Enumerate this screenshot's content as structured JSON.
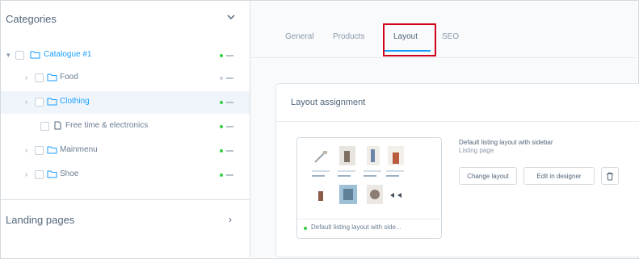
{
  "sidebar": {
    "title": "Categories",
    "tree": [
      {
        "label": "Catalogue #1",
        "color": "blue"
      },
      {
        "label": "Food",
        "color": "grey"
      },
      {
        "label": "Clothing",
        "color": "blue"
      },
      {
        "label": "Free time & electronics",
        "color": "grey"
      },
      {
        "label": "Mainmenu",
        "color": "grey"
      },
      {
        "label": "Shoe",
        "color": "grey"
      }
    ],
    "landing_pages_title": "Landing pages",
    "landing_pages_arrow": "›"
  },
  "tabs": [
    {
      "label": "General",
      "active": false
    },
    {
      "label": "Products",
      "active": false
    },
    {
      "label": "Layout",
      "active": true
    },
    {
      "label": "SEO",
      "active": false
    }
  ],
  "layout_card": {
    "title": "Layout assignment",
    "preview_name": "Default listing layout with side...",
    "layout_name": "Default listing layout with sidebar",
    "layout_type": "Listing page",
    "change_button": "Change layout",
    "edit_button": "Edit in designer"
  },
  "colors": {
    "accent": "#189eff",
    "active_dot": "#37d046",
    "highlight": "#d0021b"
  }
}
